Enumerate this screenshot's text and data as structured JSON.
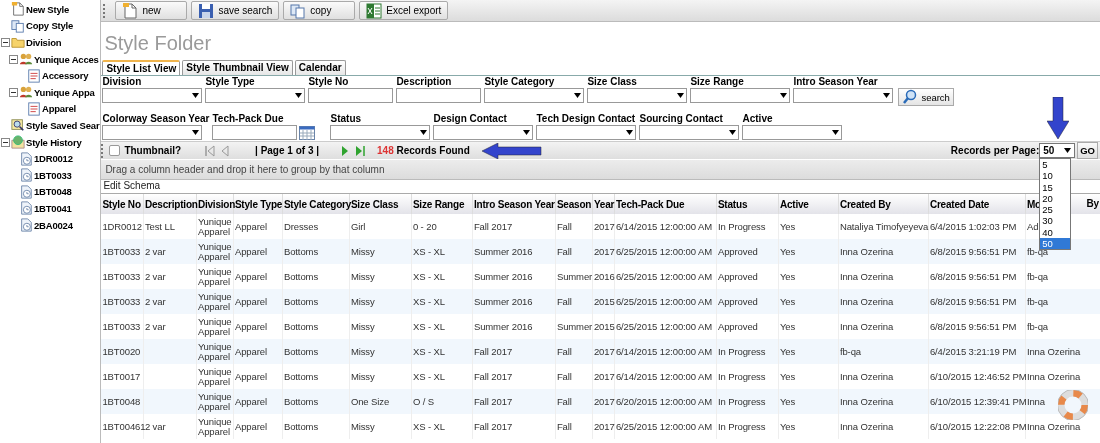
{
  "sidebar": {
    "items": [
      {
        "label": "New Style",
        "kind": "new"
      },
      {
        "label": "Copy Style",
        "kind": "copy"
      },
      {
        "label": "Division",
        "kind": "folder",
        "expanded": true,
        "children": [
          {
            "label": "Yunique Acces",
            "kind": "group",
            "expanded": true,
            "children": [
              {
                "label": "Accessory",
                "kind": "schema"
              }
            ]
          },
          {
            "label": "Yunique Appa",
            "kind": "group",
            "expanded": true,
            "children": [
              {
                "label": "Apparel",
                "kind": "schema"
              }
            ]
          }
        ]
      },
      {
        "label": "Style Saved Sear",
        "kind": "search"
      },
      {
        "label": "Style History",
        "kind": "history",
        "expanded": true,
        "children": [
          {
            "label": "1DR0012",
            "kind": "record"
          },
          {
            "label": "1BT0033",
            "kind": "record"
          },
          {
            "label": "1BT0048",
            "kind": "record"
          },
          {
            "label": "1BT0041",
            "kind": "record"
          },
          {
            "label": "2BA0024",
            "kind": "record"
          }
        ]
      }
    ]
  },
  "toolbar": {
    "buttons": [
      {
        "label": "new",
        "kind": "new"
      },
      {
        "label": "save search",
        "kind": "save"
      },
      {
        "label": "copy",
        "kind": "copy"
      },
      {
        "label": "Excel export",
        "kind": "excel"
      }
    ]
  },
  "title": "Style Folder",
  "tabs": [
    {
      "label": "Style List View",
      "selected": true
    },
    {
      "label": "Style Thumbnail View",
      "selected": false
    },
    {
      "label": "Calendar",
      "selected": false
    }
  ],
  "filters": [
    [
      {
        "label": "Division",
        "kind": "select"
      },
      {
        "label": "Style Type",
        "kind": "select"
      },
      {
        "label": "Style No",
        "kind": "text"
      },
      {
        "label": "Description",
        "kind": "text"
      },
      {
        "label": "Style Category",
        "kind": "select"
      },
      {
        "label": "Size Class",
        "kind": "select"
      },
      {
        "label": "Size Range",
        "kind": "select"
      },
      {
        "label": "Intro Season Year",
        "kind": "select"
      },
      {
        "label": "search",
        "kind": "button"
      }
    ],
    [
      {
        "label": "Colorway Season Year",
        "kind": "select"
      },
      {
        "label": "Tech-Pack Due",
        "kind": "date"
      },
      {
        "label": "Status",
        "kind": "select"
      },
      {
        "label": "Design Contact",
        "kind": "select"
      },
      {
        "label": "Tech Design Contact",
        "kind": "select"
      },
      {
        "label": "Sourcing Contact",
        "kind": "select"
      },
      {
        "label": "Active",
        "kind": "select"
      }
    ]
  ],
  "pager": {
    "thumbnail": {
      "label": "Thumbnail?",
      "checked": false
    },
    "nav": [
      {
        "kind": "first",
        "disabled": true
      },
      {
        "kind": "prev",
        "disabled": true
      },
      {
        "kind": "page",
        "label": "| Page 1 of 3 |"
      },
      {
        "kind": "next",
        "disabled": false
      },
      {
        "kind": "last",
        "disabled": false
      }
    ],
    "count": "148",
    "count_label": "Records Found",
    "records_per_page": {
      "label": "Records per Page:",
      "value": "50",
      "expanded": true,
      "options": [
        {
          "label": "5",
          "selected": false
        },
        {
          "label": "10",
          "selected": false
        },
        {
          "label": "15",
          "selected": false
        },
        {
          "label": "20",
          "selected": false
        },
        {
          "label": "25",
          "selected": false
        },
        {
          "label": "30",
          "selected": false
        },
        {
          "label": "40",
          "selected": false
        },
        {
          "label": "50",
          "selected": true
        }
      ]
    },
    "go": "GO"
  },
  "group_hint": "Drag a column header and drop it here to group by that column",
  "edit_schema": "Edit Schema",
  "table": {
    "columns": [
      "Style No",
      "Description",
      "Division",
      "Style Type",
      "Style Category",
      "Size Class",
      "Size Range",
      "Intro Season Year",
      "Season",
      "Year",
      "Tech-Pack Due",
      "Status",
      "Active",
      "Created By",
      "Created Date",
      "Mo"
    ],
    "last_header_tail": "By",
    "rows": [
      [
        "1DR0012",
        "Test LL",
        "Yunique Apparel",
        "Apparel",
        "Dresses",
        "Girl",
        "0 - 20",
        "Fall 2017",
        "Fall",
        "2017",
        "6/14/2015 12:00:00 AM",
        "In Progress",
        "Yes",
        "Nataliya Timofyeyeva",
        "6/4/2015 1:02:03 PM",
        "Ad"
      ],
      [
        "1BT0033",
        "2 var",
        "Yunique Apparel",
        "Apparel",
        "Bottoms",
        "Missy",
        "XS - XL",
        "Summer 2016",
        "Fall",
        "2017",
        "6/25/2015 12:00:00 AM",
        "Approved",
        "Yes",
        "Inna Ozerina",
        "6/8/2015 9:56:51 PM",
        "fb-qa"
      ],
      [
        "1BT0033",
        "2 var",
        "Yunique Apparel",
        "Apparel",
        "Bottoms",
        "Missy",
        "XS - XL",
        "Summer 2016",
        "Summer",
        "2016",
        "6/25/2015 12:00:00 AM",
        "Approved",
        "Yes",
        "Inna Ozerina",
        "6/8/2015 9:56:51 PM",
        "fb-qa"
      ],
      [
        "1BT0033",
        "2 var",
        "Yunique Apparel",
        "Apparel",
        "Bottoms",
        "Missy",
        "XS - XL",
        "Summer 2016",
        "Fall",
        "2015",
        "6/25/2015 12:00:00 AM",
        "Approved",
        "Yes",
        "Inna Ozerina",
        "6/8/2015 9:56:51 PM",
        "fb-qa"
      ],
      [
        "1BT0033",
        "2 var",
        "Yunique Apparel",
        "Apparel",
        "Bottoms",
        "Missy",
        "XS - XL",
        "Summer 2016",
        "Summer",
        "2015",
        "6/25/2015 12:00:00 AM",
        "Approved",
        "Yes",
        "Inna Ozerina",
        "6/8/2015 9:56:51 PM",
        "fb-qa"
      ],
      [
        "1BT0020",
        null,
        "Yunique Apparel",
        "Apparel",
        "Bottoms",
        "Missy",
        "XS - XL",
        "Fall 2017",
        "Fall",
        "2017",
        "6/14/2015 12:00:00 AM",
        "In Progress",
        "Yes",
        "fb-qa",
        "6/4/2015 3:21:19 PM",
        "Inna Ozerina"
      ],
      [
        "1BT0017",
        null,
        "Yunique Apparel",
        "Apparel",
        "Bottoms",
        "Missy",
        "XS - XL",
        "Fall 2017",
        "Fall",
        "2017",
        "6/14/2015 12:00:00 AM",
        "In Progress",
        "Yes",
        "Inna Ozerina",
        "6/10/2015 12:46:52 PM",
        "Inna Ozerina"
      ],
      [
        "1BT0048",
        null,
        "Yunique Apparel",
        "Apparel",
        "Bottoms",
        "One Size",
        "O / S",
        "Fall 2017",
        "Fall",
        "2017",
        "6/20/2015 12:00:00 AM",
        "In Progress",
        "Yes",
        "Inna Ozerina",
        "6/10/2015 12:39:41 PM",
        "Inna"
      ],
      [
        "1BT00461",
        "2 var",
        "Yunique Apparel",
        "Apparel",
        "Bottoms",
        "Missy",
        "XS - XL",
        "Fall 2017",
        "Fall",
        "2017",
        "6/25/2015 12:00:00 AM",
        "In Progress",
        "Yes",
        "Inna Ozerina",
        "6/10/2015 12:22:08 PM",
        "Inna Ozerina"
      ]
    ]
  }
}
